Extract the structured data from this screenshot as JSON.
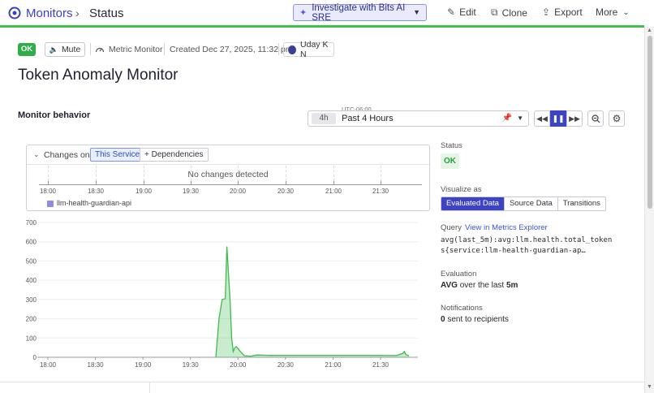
{
  "breadcrumb": {
    "root": "Monitors",
    "separator": "›",
    "current": "Status"
  },
  "toolbar": {
    "bits_label": "Investigate with Bits AI SRE",
    "edit_label": "Edit",
    "clone_label": "Clone",
    "export_label": "Export",
    "more_label": "More"
  },
  "meta": {
    "status_badge": "OK",
    "mute_label": "Mute",
    "monitor_type": "Metric Monitor",
    "created": "Created Dec 27, 2025, 11:32 pm",
    "user": "Uday K N"
  },
  "title": "Token Anomaly Monitor",
  "section": {
    "label": "Monitor behavior"
  },
  "time": {
    "timezone": "UTC-06:00",
    "chip": "4h",
    "range_label": "Past 4 Hours"
  },
  "changes": {
    "header": "Changes on",
    "scope_options": [
      "This Service",
      "+ Dependencies"
    ],
    "empty_text": "No changes detected",
    "axis_labels": [
      "18:00",
      "18:30",
      "19:00",
      "19:30",
      "20:00",
      "20:30",
      "21:00",
      "21:30"
    ],
    "legend": "llm-health-guardian-api"
  },
  "chart_data": {
    "type": "area",
    "x": [
      "18:00",
      "18:30",
      "19:00",
      "19:30",
      "20:00",
      "20:30",
      "21:00",
      "21:30"
    ],
    "y_ticks": [
      0,
      100,
      200,
      300,
      400,
      500,
      600,
      700
    ],
    "ylim": [
      0,
      700
    ],
    "color": "#3fba4f",
    "series": [
      {
        "points": [
          [
            "19:46",
            0
          ],
          [
            "19:48",
            200
          ],
          [
            "19:50",
            300
          ],
          [
            "19:52",
            305
          ],
          [
            "19:53",
            575
          ],
          [
            "19:55",
            300
          ],
          [
            "19:56",
            100
          ],
          [
            "19:57",
            30
          ],
          [
            "19:58",
            50
          ],
          [
            "19:59",
            55
          ],
          [
            "20:00",
            45
          ],
          [
            "20:01",
            35
          ],
          [
            "20:02",
            25
          ],
          [
            "20:04",
            8
          ],
          [
            "20:08",
            6
          ],
          [
            "20:12",
            12
          ],
          [
            "20:20",
            10
          ],
          [
            "20:40",
            10
          ],
          [
            "21:00",
            10
          ],
          [
            "21:20",
            10
          ],
          [
            "21:40",
            9
          ],
          [
            "21:44",
            20
          ],
          [
            "21:45",
            30
          ],
          [
            "21:46",
            14
          ],
          [
            "21:48",
            8
          ]
        ]
      }
    ]
  },
  "status_panel": {
    "status_label": "Status",
    "status_value": "OK",
    "visualize_label": "Visualize as",
    "visualize_options": [
      "Evaluated Data",
      "Source Data",
      "Transitions"
    ],
    "query_label": "Query",
    "query_link": "View in Metrics Explorer",
    "query_text": "avg(last_5m):avg:llm.health.total_tokens{service:llm-health-guardian-ap…",
    "evaluation_label": "Evaluation",
    "evaluation_agg": "AVG",
    "evaluation_mid": " over the last ",
    "evaluation_window": "5m",
    "notifications_label": "Notifications",
    "notifications_count": "0",
    "notifications_text": " sent to recipients"
  }
}
